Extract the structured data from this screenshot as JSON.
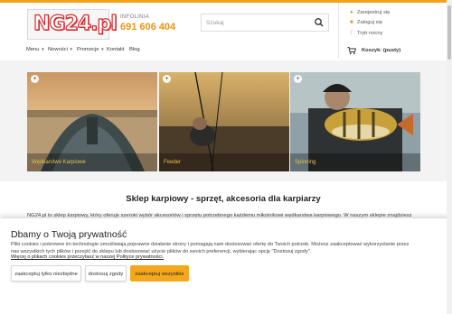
{
  "header": {
    "logo_text": "NG24.pl",
    "info_label": "INFOLINIA",
    "phone": "691 606 404",
    "search_placeholder": "Szukaj"
  },
  "account": {
    "register": "Zarejestruj się",
    "login": "Zaloguj się",
    "shipping": "Tryb nocny"
  },
  "nav": {
    "menu": "Menu",
    "news": "Nowości",
    "promos": "Promocje",
    "contact": "Kontakt",
    "blog": "Blog"
  },
  "cart": {
    "label": "Koszyk: (pusty)"
  },
  "tiles": [
    {
      "label": "Wędkarstwo Karpiowe"
    },
    {
      "label": "Feeder"
    },
    {
      "label": "Spinning"
    }
  ],
  "main": {
    "title": "Sklep karpiowy - sprzęt, akcesoria dla karpiarzy",
    "intro": "NG24.pl to sklep karpiowy, który oferuje szeroki wybór akcesoriów i sprzętu potrzebnego każdemu miłośnikowi wędkarstwa karpiowego. W naszym sklepie znajdziesz"
  },
  "cookie": {
    "title": "Dbamy o Twoją prywatność",
    "text_line1": "Pliki cookies i pokrewne im technologie umożliwiają poprawne działanie strony i pomagają nam dostosować ofertę do Twoich potrzeb. Możesz zaakceptować wykorzystanie przez",
    "text_line2": "nas wszystkich tych plików i przejść do sklepu lub dostosować użycie plików do swoich preferencji, wybierając opcję \"Dostosuj zgody\".",
    "link": "Więcej o plikach cookies przeczytasz w naszej Polityce prywatności.",
    "btn_necessary": "zaakceptuj tylko niezbędne",
    "btn_customize": "dostosuj zgody",
    "btn_accept_all": "zaakceptuj wszystkie"
  },
  "colors": {
    "accent": "#f5a81d",
    "logo_red": "#d32f2f",
    "tile_label": "#e8c24a"
  }
}
